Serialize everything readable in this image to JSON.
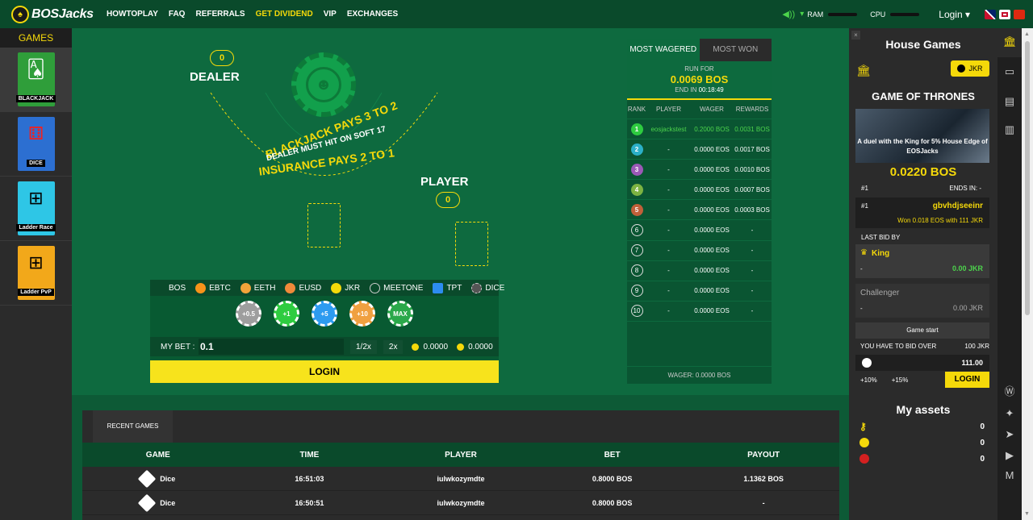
{
  "header": {
    "logo_text": "BOSJacks",
    "nav": [
      "HOWTOPLAY",
      "FAQ",
      "REFERRALS",
      "GET DIVIDEND",
      "VIP",
      "EXCHANGES"
    ],
    "ram_label": "RAM",
    "cpu_label": "CPU",
    "login_label": "Login",
    "highlight_color": "#f5d90a"
  },
  "sidebar": {
    "title": "GAMES",
    "games": [
      {
        "label": "BLACKJACK",
        "icon": "cards-icon"
      },
      {
        "label": "DICE",
        "icon": "dice-icon"
      },
      {
        "label": "Ladder Race",
        "icon": "ladder-icon"
      },
      {
        "label": "Ladder PvP",
        "icon": "ladder-icon"
      }
    ]
  },
  "table": {
    "dealer_label": "DEALER",
    "dealer_score": "0",
    "player_label": "PLAYER",
    "player_score": "0",
    "line1": "BLACKJACK PAYS 3 TO 2",
    "line2": "DEALER MUST HIT ON SOFT 17",
    "line3": "INSURANCE PAYS 2 TO 1"
  },
  "bet": {
    "currencies": [
      "BOS",
      "EBTC",
      "EETH",
      "EUSD",
      "JKR",
      "MEETONE",
      "TPT",
      "DICE"
    ],
    "chips": [
      "+0.5",
      "+1",
      "+5",
      "+10",
      "MAX"
    ],
    "my_bet_label": "MY BET :",
    "my_bet_value": "0.1",
    "half_label": "1/2x",
    "double_label": "2x",
    "balance1": "0.0000",
    "balance2": "0.0000",
    "login_label": "LOGIN"
  },
  "leaderboard": {
    "tab_active": "MOST WAGERED",
    "tab_inactive": "MOST WON",
    "run_for_label": "RUN FOR",
    "run_for_amount": "0.0069 BOS",
    "end_in_label": "END IN",
    "end_in_value": "00:18:49",
    "headers": [
      "RANK",
      "PLAYER",
      "WAGER",
      "REWARDS"
    ],
    "rows": [
      {
        "rank": "1",
        "player": "eosjackstest",
        "wager": "0.2000 BOS",
        "reward": "0.0031 BOS"
      },
      {
        "rank": "2",
        "player": "-",
        "wager": "0.0000 EOS",
        "reward": "0.0017 BOS"
      },
      {
        "rank": "3",
        "player": "-",
        "wager": "0.0000 EOS",
        "reward": "0.0010 BOS"
      },
      {
        "rank": "4",
        "player": "-",
        "wager": "0.0000 EOS",
        "reward": "0.0007 BOS"
      },
      {
        "rank": "5",
        "player": "-",
        "wager": "0.0000 EOS",
        "reward": "0.0003 BOS"
      },
      {
        "rank": "6",
        "player": "-",
        "wager": "0.0000 EOS",
        "reward": "-"
      },
      {
        "rank": "7",
        "player": "-",
        "wager": "0.0000 EOS",
        "reward": "-"
      },
      {
        "rank": "8",
        "player": "-",
        "wager": "0.0000 EOS",
        "reward": "-"
      },
      {
        "rank": "9",
        "player": "-",
        "wager": "0.0000 EOS",
        "reward": "-"
      },
      {
        "rank": "10",
        "player": "-",
        "wager": "0.0000 EOS",
        "reward": "-"
      }
    ],
    "footer": "WAGER: 0.0000 BOS"
  },
  "recent": {
    "tab": "RECENT GAMES",
    "headers": [
      "GAME",
      "TIME",
      "PLAYER",
      "BET",
      "PAYOUT"
    ],
    "rows": [
      {
        "game": "Dice",
        "time": "16:51:03",
        "player": "iulwkozymdte",
        "bet": "0.8000 BOS",
        "payout": "1.1362 BOS"
      },
      {
        "game": "Dice",
        "time": "16:50:51",
        "player": "iulwkozymdte",
        "bet": "0.8000 BOS",
        "payout": "-"
      }
    ]
  },
  "house": {
    "title": "House Games",
    "token_button": "JKR",
    "got_title": "GAME OF THRONES",
    "banner_text": "A duel with the King for 5% House Edge of EOSJacks",
    "prize": "0.0220 BOS",
    "rank_label": "#1",
    "ends_in": "ENDS IN:",
    "ends_val": "-",
    "winner_rank": "#1",
    "winner_name": "gbvhdjseeinr",
    "winner_note": "Won 0.018 EOS with 111 JKR",
    "last_bid_label": "LAST BID BY",
    "king_label": "King",
    "king_dash": "-",
    "king_value": "0.00 JKR",
    "challenger_label": "Challenger",
    "challenger_dash": "-",
    "challenger_value": "0.00 JKR",
    "game_start": "Game start",
    "bid_over_label": "YOU HAVE TO BID OVER",
    "bid_over_value": "100 JKR",
    "bid_value": "111.00",
    "plus10": "+10%",
    "plus15": "+15%",
    "login": "LOGIN",
    "assets_title": "My assets",
    "assets": [
      "0",
      "0",
      "0"
    ]
  }
}
